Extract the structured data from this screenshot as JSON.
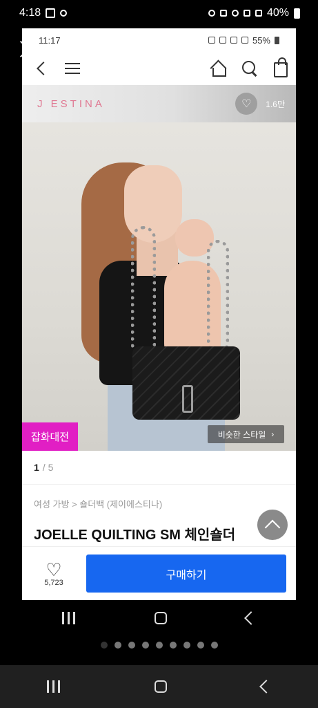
{
  "outer_status": {
    "time": "4:18",
    "battery": "40%"
  },
  "inner_status": {
    "time": "11:17",
    "battery": "55%"
  },
  "brand": {
    "name": "J ESTINA",
    "wish_count": "1.6만"
  },
  "hero": {
    "promo_label": "잡화대전",
    "similar_label": "비슷한 스타일"
  },
  "pager": {
    "current": "1",
    "total": "5"
  },
  "breadcrumb": "여성 가방 > 숄더백 (제이에스티나)",
  "product": {
    "title": "JOELLE QUILTING SM 체인숄더"
  },
  "bottom": {
    "like_count": "5,723",
    "buy_label": "구매하기"
  },
  "icons": {
    "close": "close-icon",
    "back": "chevron-left-icon",
    "menu": "menu-icon",
    "home": "home-icon",
    "search": "search-icon",
    "cart": "shopping-bag-icon",
    "heart": "heart-icon",
    "scroll_top": "chevron-up-icon"
  },
  "colors": {
    "brand_pink": "#e07892",
    "promo_magenta": "#e11fc4",
    "buy_blue": "#1767f0"
  }
}
